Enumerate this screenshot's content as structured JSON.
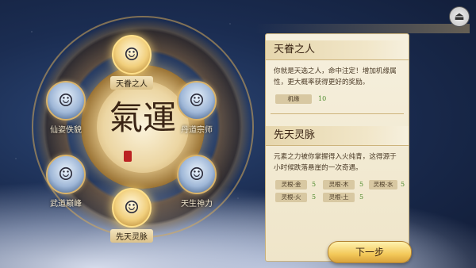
{
  "nodes": [
    {
      "id": "tianjuan",
      "label": "天眷之人",
      "icon": "portrait-icon",
      "selected": true
    },
    {
      "id": "xianzi",
      "label": "仙姿佚貌",
      "icon": "portrait-icon",
      "selected": false
    },
    {
      "id": "dandao",
      "label": "丹道宗师",
      "icon": "portrait-icon",
      "selected": false
    },
    {
      "id": "wudao",
      "label": "武道巅峰",
      "icon": "portrait-icon",
      "selected": false
    },
    {
      "id": "tiansheng",
      "label": "天生神力",
      "icon": "portrait-icon",
      "selected": false
    },
    {
      "id": "xiantian",
      "label": "先天灵脉",
      "icon": "portrait-icon",
      "selected": true
    }
  ],
  "center": {
    "glyph": "氣運"
  },
  "panel": {
    "sec1": {
      "title": "天眷之人",
      "desc": "你就是天选之人，命中注定！增加机缘属性，更大概率获得更好的奖励。",
      "attrs": [
        {
          "name": "机缘",
          "value": "10"
        }
      ]
    },
    "sec2": {
      "title": "先天灵脉",
      "desc": "元素之力被你掌握得入火纯青，这得源于小时候跌落悬崖的一次奇遇。",
      "attrs": [
        {
          "name": "灵根-金",
          "value": "5"
        },
        {
          "name": "灵根-木",
          "value": "5"
        },
        {
          "name": "灵根-水",
          "value": "5"
        },
        {
          "name": "灵根-火",
          "value": "5"
        },
        {
          "name": "灵根-土",
          "value": "5"
        }
      ]
    }
  },
  "buttons": {
    "next": "下一步",
    "back_icon": "back-arrow-icon"
  }
}
